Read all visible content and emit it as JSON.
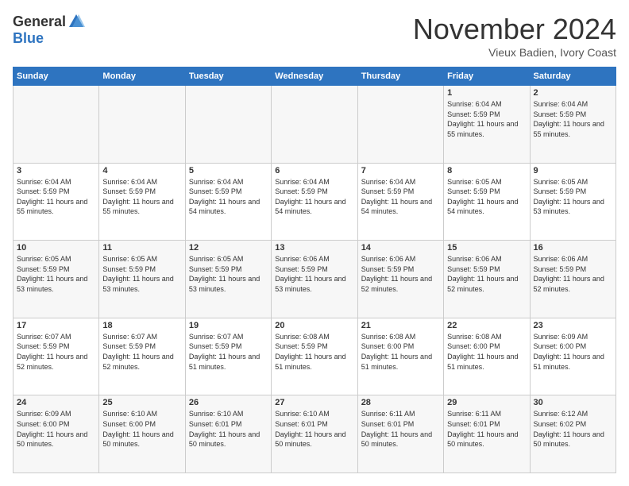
{
  "header": {
    "logo_general": "General",
    "logo_blue": "Blue",
    "month_title": "November 2024",
    "location": "Vieux Badien, Ivory Coast"
  },
  "calendar": {
    "headers": [
      "Sunday",
      "Monday",
      "Tuesday",
      "Wednesday",
      "Thursday",
      "Friday",
      "Saturday"
    ],
    "weeks": [
      [
        {
          "day": "",
          "info": ""
        },
        {
          "day": "",
          "info": ""
        },
        {
          "day": "",
          "info": ""
        },
        {
          "day": "",
          "info": ""
        },
        {
          "day": "",
          "info": ""
        },
        {
          "day": "1",
          "info": "Sunrise: 6:04 AM\nSunset: 5:59 PM\nDaylight: 11 hours and 55 minutes."
        },
        {
          "day": "2",
          "info": "Sunrise: 6:04 AM\nSunset: 5:59 PM\nDaylight: 11 hours and 55 minutes."
        }
      ],
      [
        {
          "day": "3",
          "info": "Sunrise: 6:04 AM\nSunset: 5:59 PM\nDaylight: 11 hours and 55 minutes."
        },
        {
          "day": "4",
          "info": "Sunrise: 6:04 AM\nSunset: 5:59 PM\nDaylight: 11 hours and 55 minutes."
        },
        {
          "day": "5",
          "info": "Sunrise: 6:04 AM\nSunset: 5:59 PM\nDaylight: 11 hours and 54 minutes."
        },
        {
          "day": "6",
          "info": "Sunrise: 6:04 AM\nSunset: 5:59 PM\nDaylight: 11 hours and 54 minutes."
        },
        {
          "day": "7",
          "info": "Sunrise: 6:04 AM\nSunset: 5:59 PM\nDaylight: 11 hours and 54 minutes."
        },
        {
          "day": "8",
          "info": "Sunrise: 6:05 AM\nSunset: 5:59 PM\nDaylight: 11 hours and 54 minutes."
        },
        {
          "day": "9",
          "info": "Sunrise: 6:05 AM\nSunset: 5:59 PM\nDaylight: 11 hours and 53 minutes."
        }
      ],
      [
        {
          "day": "10",
          "info": "Sunrise: 6:05 AM\nSunset: 5:59 PM\nDaylight: 11 hours and 53 minutes."
        },
        {
          "day": "11",
          "info": "Sunrise: 6:05 AM\nSunset: 5:59 PM\nDaylight: 11 hours and 53 minutes."
        },
        {
          "day": "12",
          "info": "Sunrise: 6:05 AM\nSunset: 5:59 PM\nDaylight: 11 hours and 53 minutes."
        },
        {
          "day": "13",
          "info": "Sunrise: 6:06 AM\nSunset: 5:59 PM\nDaylight: 11 hours and 53 minutes."
        },
        {
          "day": "14",
          "info": "Sunrise: 6:06 AM\nSunset: 5:59 PM\nDaylight: 11 hours and 52 minutes."
        },
        {
          "day": "15",
          "info": "Sunrise: 6:06 AM\nSunset: 5:59 PM\nDaylight: 11 hours and 52 minutes."
        },
        {
          "day": "16",
          "info": "Sunrise: 6:06 AM\nSunset: 5:59 PM\nDaylight: 11 hours and 52 minutes."
        }
      ],
      [
        {
          "day": "17",
          "info": "Sunrise: 6:07 AM\nSunset: 5:59 PM\nDaylight: 11 hours and 52 minutes."
        },
        {
          "day": "18",
          "info": "Sunrise: 6:07 AM\nSunset: 5:59 PM\nDaylight: 11 hours and 52 minutes."
        },
        {
          "day": "19",
          "info": "Sunrise: 6:07 AM\nSunset: 5:59 PM\nDaylight: 11 hours and 51 minutes."
        },
        {
          "day": "20",
          "info": "Sunrise: 6:08 AM\nSunset: 5:59 PM\nDaylight: 11 hours and 51 minutes."
        },
        {
          "day": "21",
          "info": "Sunrise: 6:08 AM\nSunset: 6:00 PM\nDaylight: 11 hours and 51 minutes."
        },
        {
          "day": "22",
          "info": "Sunrise: 6:08 AM\nSunset: 6:00 PM\nDaylight: 11 hours and 51 minutes."
        },
        {
          "day": "23",
          "info": "Sunrise: 6:09 AM\nSunset: 6:00 PM\nDaylight: 11 hours and 51 minutes."
        }
      ],
      [
        {
          "day": "24",
          "info": "Sunrise: 6:09 AM\nSunset: 6:00 PM\nDaylight: 11 hours and 50 minutes."
        },
        {
          "day": "25",
          "info": "Sunrise: 6:10 AM\nSunset: 6:00 PM\nDaylight: 11 hours and 50 minutes."
        },
        {
          "day": "26",
          "info": "Sunrise: 6:10 AM\nSunset: 6:01 PM\nDaylight: 11 hours and 50 minutes."
        },
        {
          "day": "27",
          "info": "Sunrise: 6:10 AM\nSunset: 6:01 PM\nDaylight: 11 hours and 50 minutes."
        },
        {
          "day": "28",
          "info": "Sunrise: 6:11 AM\nSunset: 6:01 PM\nDaylight: 11 hours and 50 minutes."
        },
        {
          "day": "29",
          "info": "Sunrise: 6:11 AM\nSunset: 6:01 PM\nDaylight: 11 hours and 50 minutes."
        },
        {
          "day": "30",
          "info": "Sunrise: 6:12 AM\nSunset: 6:02 PM\nDaylight: 11 hours and 50 minutes."
        }
      ]
    ]
  }
}
